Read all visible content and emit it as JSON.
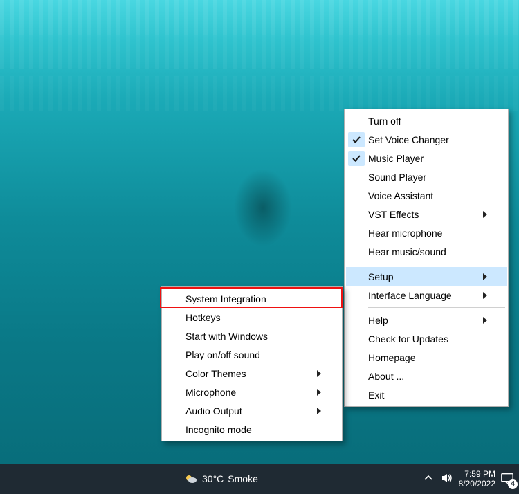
{
  "primary_menu": {
    "items": [
      {
        "label": "Turn off",
        "checked": false,
        "submenu": false
      },
      {
        "label": "Set Voice Changer",
        "checked": true,
        "submenu": false
      },
      {
        "label": "Music Player",
        "checked": true,
        "submenu": false
      },
      {
        "label": "Sound Player",
        "checked": false,
        "submenu": false
      },
      {
        "label": "Voice Assistant",
        "checked": false,
        "submenu": false
      },
      {
        "label": "VST Effects",
        "checked": false,
        "submenu": true
      },
      {
        "label": "Hear microphone",
        "checked": false,
        "submenu": false
      },
      {
        "label": "Hear music/sound",
        "checked": false,
        "submenu": false
      }
    ],
    "setup": {
      "label": "Setup",
      "submenu": true,
      "selected": true
    },
    "interface_language": {
      "label": "Interface Language",
      "submenu": true
    },
    "help": {
      "label": "Help",
      "submenu": true
    },
    "check_updates": {
      "label": "Check for Updates"
    },
    "homepage": {
      "label": "Homepage"
    },
    "about": {
      "label": "About ..."
    },
    "exit": {
      "label": "Exit"
    }
  },
  "submenu": {
    "items": [
      {
        "label": "System Integration",
        "highlighted": true
      },
      {
        "label": "Hotkeys"
      },
      {
        "label": "Start with Windows"
      },
      {
        "label": "Play on/off sound"
      },
      {
        "label": "Color Themes",
        "submenu": true
      },
      {
        "label": "Microphone",
        "submenu": true
      },
      {
        "label": "Audio Output",
        "submenu": true
      },
      {
        "label": "Incognito mode"
      }
    ]
  },
  "taskbar": {
    "weather_temp": "30°C",
    "weather_desc": "Smoke",
    "time": "7:59 PM",
    "date": "8/20/2022",
    "notif_count": "4"
  }
}
